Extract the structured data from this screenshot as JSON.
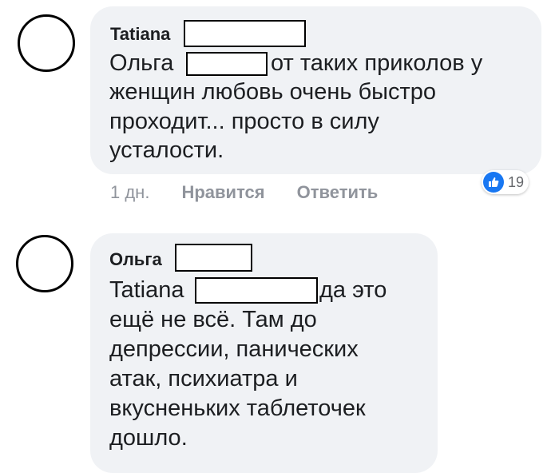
{
  "comments": [
    {
      "author": "Tatiana",
      "lines": [
        "Ольга",
        "от таких приколов у",
        "женщин любовь очень быстро",
        "проходит... просто в силу",
        "усталости."
      ],
      "time": "1 дн.",
      "like_label": "Нравится",
      "reply_label": "Ответить",
      "reaction_icon": "thumbs-up-icon",
      "reaction_count": "19"
    },
    {
      "author": "Ольга",
      "lines": [
        "Tatiana",
        "да это",
        "ещё не всё. Там до",
        "депрессии, панических",
        "атак, психиатра и",
        "вкусненьких таблеточек",
        "дошло."
      ]
    }
  ],
  "colors": {
    "bubble": "#f0f2f5",
    "meta_text": "#90949c",
    "like_blue": "#1877f2"
  }
}
